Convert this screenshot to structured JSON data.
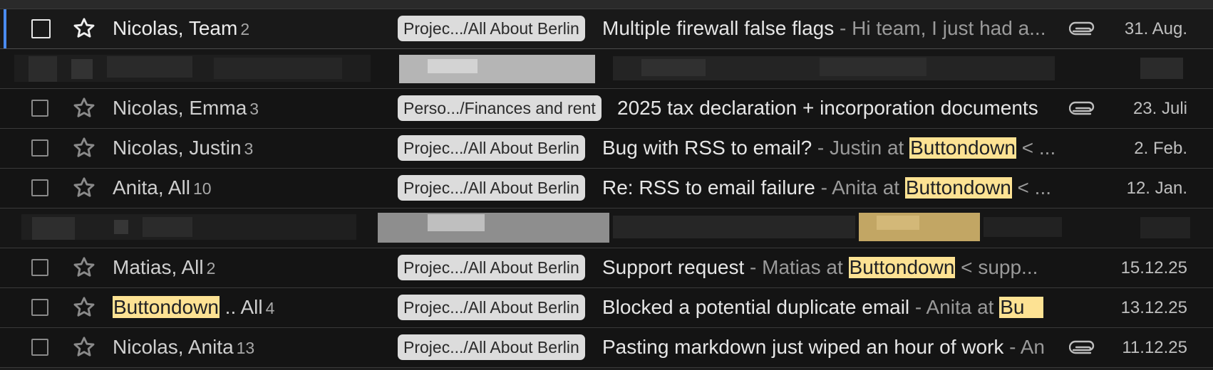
{
  "colors": {
    "selected_accent": "#4a8bf0",
    "highlight": "#fde293",
    "label_bg": "#dcdcdc"
  },
  "icons": {
    "checkbox": "checkbox-icon",
    "star": "star-icon",
    "attachment": "paperclip-icon"
  },
  "rows": [
    {
      "sender": "Nicolas, Team",
      "count": "2",
      "label": "Projec.../All About Berlin",
      "subject": "Multiple firewall false flags",
      "snippet": " - Hi team, I just had a...",
      "attachment": true,
      "date": "31. Aug.",
      "selected": true
    },
    {
      "blurred": true
    },
    {
      "sender": "Nicolas, Emma",
      "count": "3",
      "label": "Perso.../Finances and rent",
      "subject": "2025 tax declaration + incorporation documents",
      "snippet": "",
      "attachment": true,
      "date": "23. Juli"
    },
    {
      "sender": "Nicolas, Justin",
      "count": "3",
      "label": "Projec.../All About Berlin",
      "subject": "Bug with RSS to email?",
      "snippet_pre": " - Justin at ",
      "snippet_hl": "Buttondown",
      "snippet_post": " < ...",
      "attachment": false,
      "date": "2. Feb."
    },
    {
      "sender": "Anita, All",
      "count": "10",
      "label": "Projec.../All About Berlin",
      "subject": "Re: RSS to email failure",
      "snippet_pre": " - Anita at ",
      "snippet_hl": "Buttondown",
      "snippet_post": " < ...",
      "attachment": false,
      "date": "12. Jan."
    },
    {
      "blurred": true
    },
    {
      "sender": "Matias, All",
      "count": "2",
      "label": "Projec.../All About Berlin",
      "subject": "Support request",
      "snippet_pre": " - Matias at ",
      "snippet_hl": "Buttondown",
      "snippet_post": " < supp...",
      "attachment": false,
      "date": "15.12.25"
    },
    {
      "sender_hl": "Buttondown",
      "sender_post": " .. All",
      "count": "4",
      "label": "Projec.../All About Berlin",
      "subject": "Blocked a potential duplicate email",
      "snippet_pre": " - Anita at ",
      "snippet_hl": "Bu",
      "snippet_post": "",
      "attachment": false,
      "date": "13.12.25"
    },
    {
      "sender": "Nicolas, Anita",
      "count": "13",
      "label": "Projec.../All About Berlin",
      "subject": "Pasting markdown just wiped an hour of work",
      "snippet": " - An",
      "attachment": true,
      "date": "11.12.25"
    }
  ]
}
